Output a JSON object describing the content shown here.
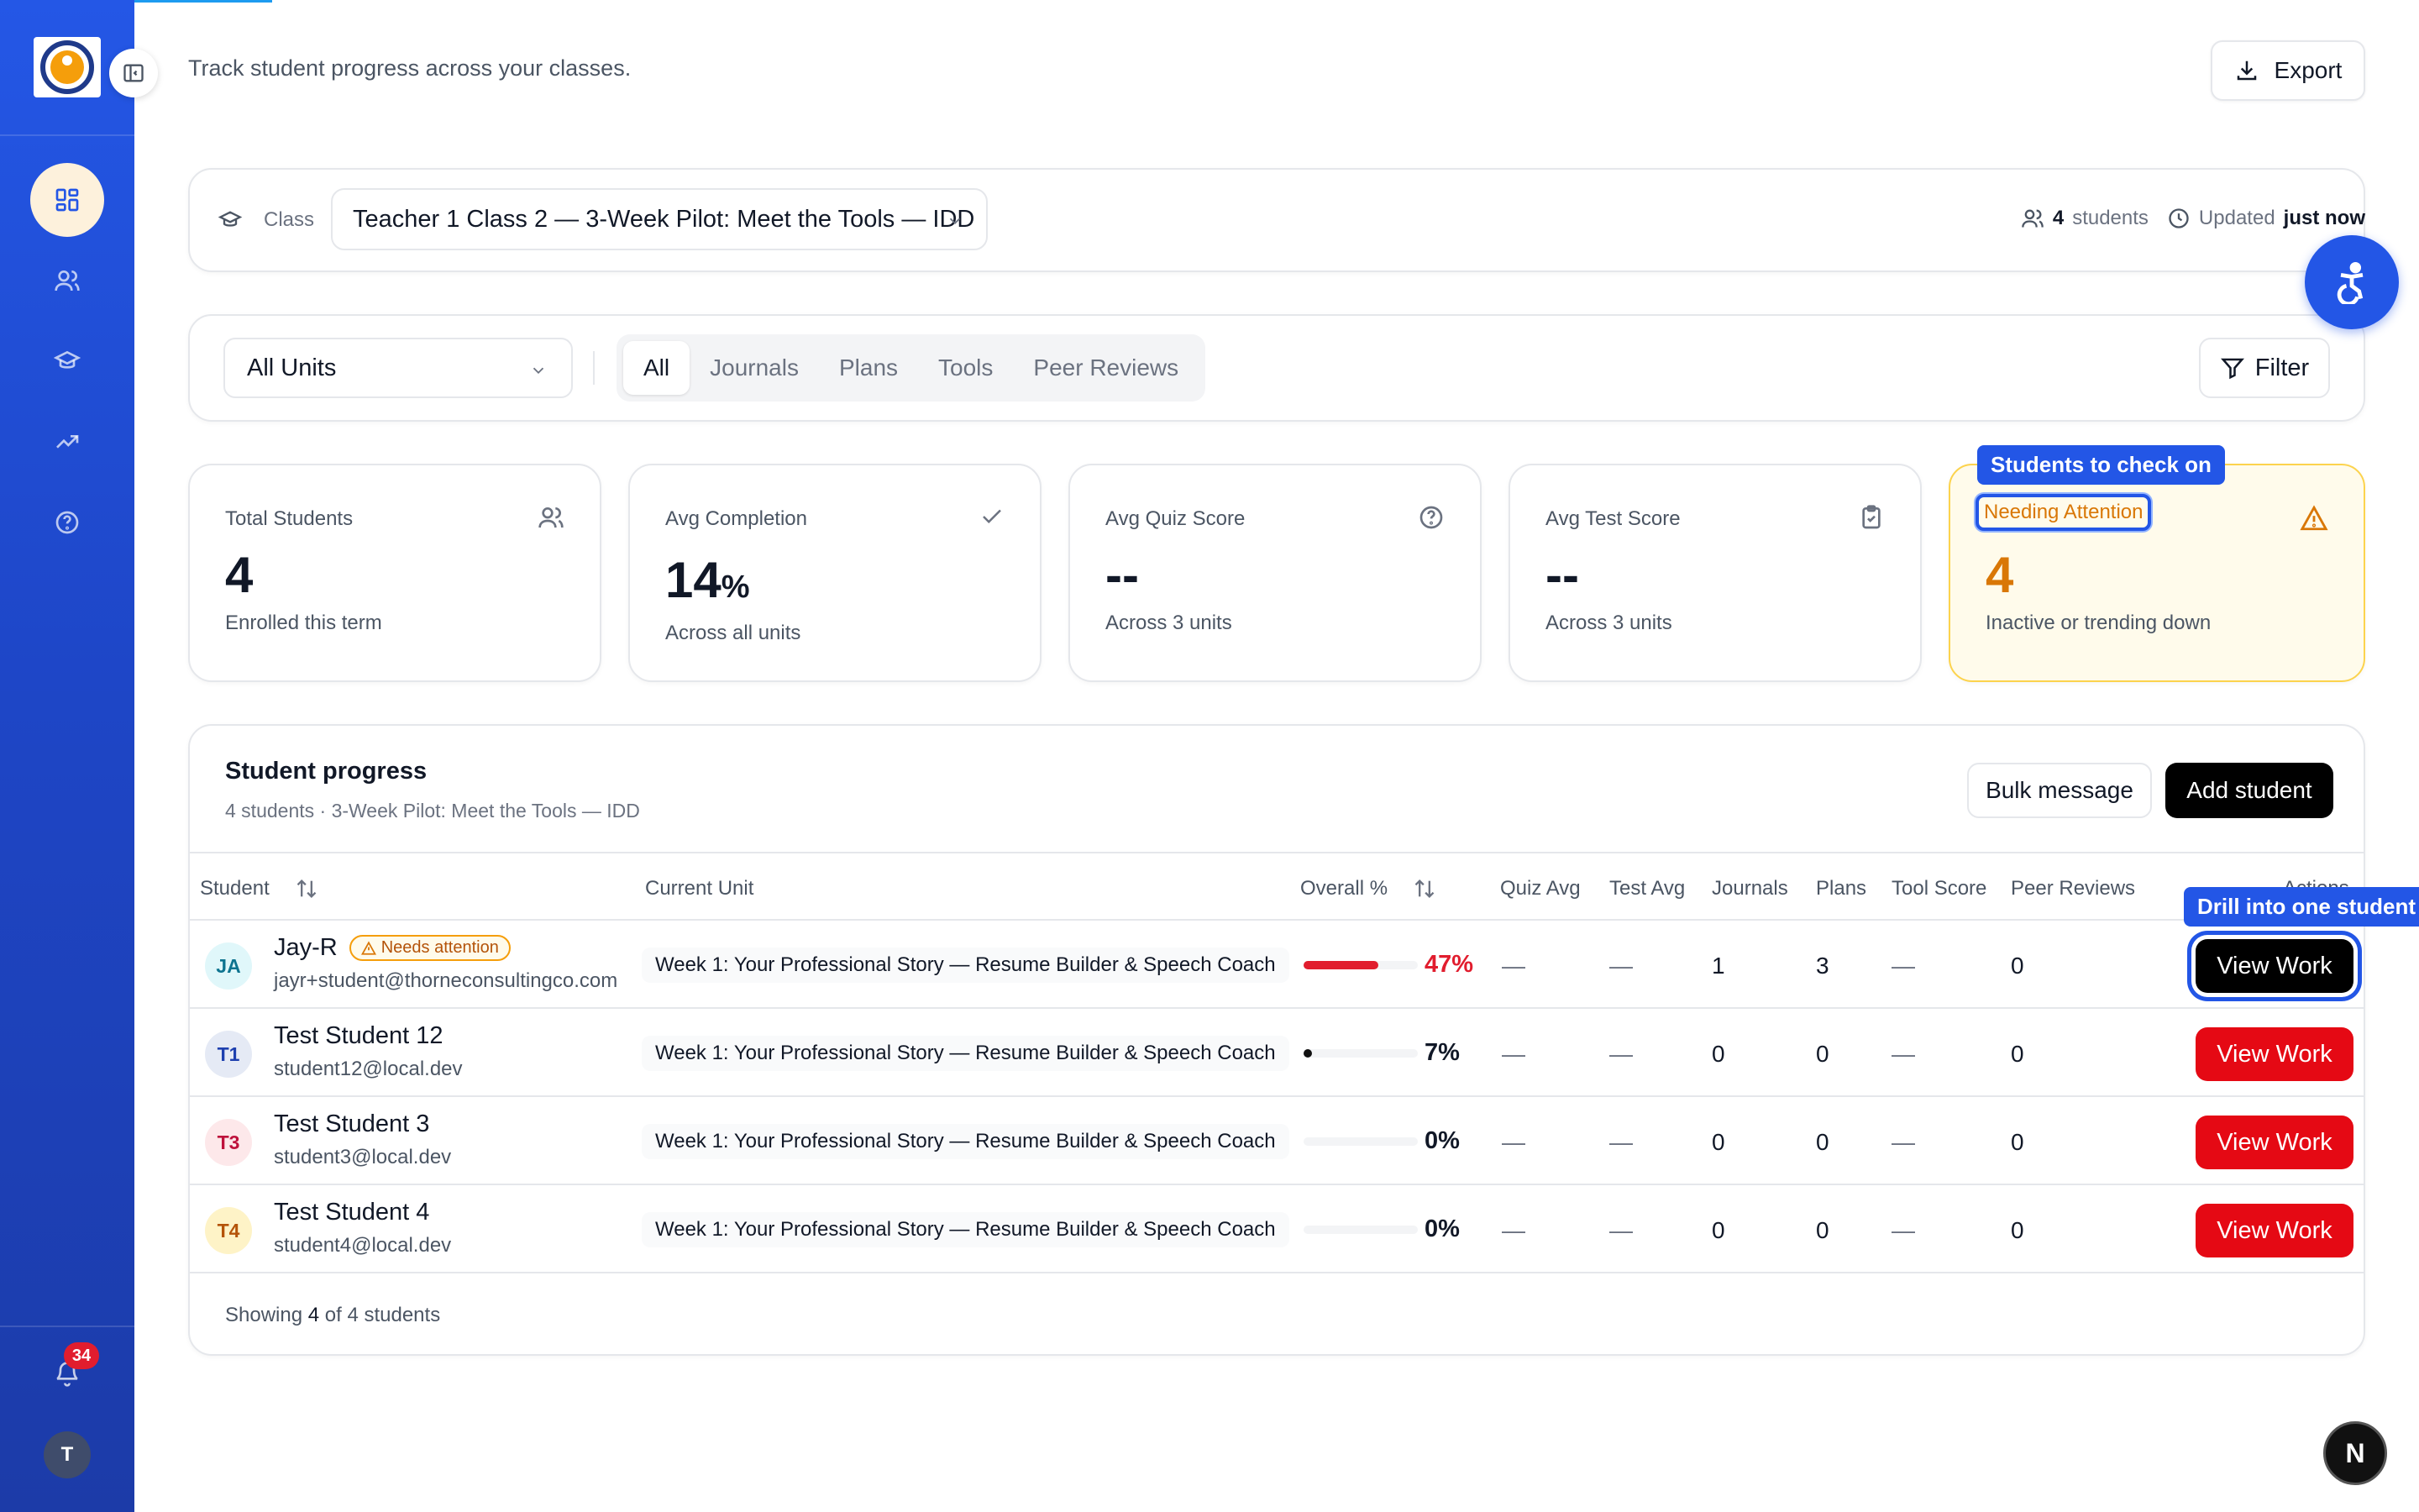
{
  "header": {
    "subtitle": "Track student progress across your classes.",
    "export_label": "Export"
  },
  "class_bar": {
    "label": "Class",
    "selected_class": "Teacher 1 Class 2 — 3-Week Pilot: Meet the Tools — IDD",
    "student_count": "4",
    "students_label": "students",
    "updated_label": "Updated",
    "updated_value": "just now"
  },
  "filters": {
    "units_selected": "All Units",
    "tabs": [
      "All",
      "Journals",
      "Plans",
      "Tools",
      "Peer Reviews"
    ],
    "active_tab": "All",
    "filter_label": "Filter"
  },
  "stats": {
    "total": {
      "label": "Total Students",
      "value": "4",
      "sub": "Enrolled this term"
    },
    "completion": {
      "label": "Avg Completion",
      "value": "14",
      "unit": "%",
      "sub": "Across all units"
    },
    "quiz": {
      "label": "Avg Quiz Score",
      "value": "--",
      "sub": "Across 3 units"
    },
    "test": {
      "label": "Avg Test Score",
      "value": "--",
      "sub": "Across 3 units"
    },
    "attention": {
      "label": "Needing Attention",
      "value": "4",
      "sub": "Inactive or trending down"
    }
  },
  "tooltips": {
    "attention": "Students to check on",
    "drill": "Drill into one student"
  },
  "progress": {
    "title": "Student progress",
    "subtitle": "4 students · 3-Week Pilot: Meet the Tools — IDD",
    "bulk_label": "Bulk message",
    "add_label": "Add student",
    "columns": {
      "student": "Student",
      "unit": "Current Unit",
      "overall": "Overall %",
      "quiz": "Quiz Avg",
      "test": "Test Avg",
      "journals": "Journals",
      "plans": "Plans",
      "tool": "Tool Score",
      "peer": "Peer Reviews",
      "actions": "Actions"
    },
    "rows": [
      {
        "initials": "JA",
        "name": "Jay-R",
        "badge": "Needs attention",
        "email": "jayr+student@thorneconsultingco.com",
        "unit": "Week 1: Your Professional Story — Resume Builder & Speech Coach",
        "overall": "47%",
        "overall_value": 47,
        "quiz": "—",
        "test": "—",
        "journals": "1",
        "plans": "3",
        "tool": "—",
        "peer": "0",
        "action": "View Work"
      },
      {
        "initials": "T1",
        "name": "Test Student 12",
        "badge": "",
        "email": "student12@local.dev",
        "unit": "Week 1: Your Professional Story — Resume Builder & Speech Coach",
        "overall": "7%",
        "overall_value": 7,
        "quiz": "—",
        "test": "—",
        "journals": "0",
        "plans": "0",
        "tool": "—",
        "peer": "0",
        "action": "View Work"
      },
      {
        "initials": "T3",
        "name": "Test Student 3",
        "badge": "",
        "email": "student3@local.dev",
        "unit": "Week 1: Your Professional Story — Resume Builder & Speech Coach",
        "overall": "0%",
        "overall_value": 0,
        "quiz": "—",
        "test": "—",
        "journals": "0",
        "plans": "0",
        "tool": "—",
        "peer": "0",
        "action": "View Work"
      },
      {
        "initials": "T4",
        "name": "Test Student 4",
        "badge": "",
        "email": "student4@local.dev",
        "unit": "Week 1: Your Professional Story — Resume Builder & Speech Coach",
        "overall": "0%",
        "overall_value": 0,
        "quiz": "—",
        "test": "—",
        "journals": "0",
        "plans": "0",
        "tool": "—",
        "peer": "0",
        "action": "View Work"
      }
    ],
    "showing_prefix": "Showing",
    "showing_count": "4",
    "showing_suffix": "of 4 students"
  },
  "sidebar": {
    "notification_count": "34",
    "user_initial": "T"
  },
  "dev_badge": "N",
  "colors": {
    "brand_blue": "#2356e6",
    "danger_red": "#e50914",
    "warning_amber": "#d97706"
  }
}
